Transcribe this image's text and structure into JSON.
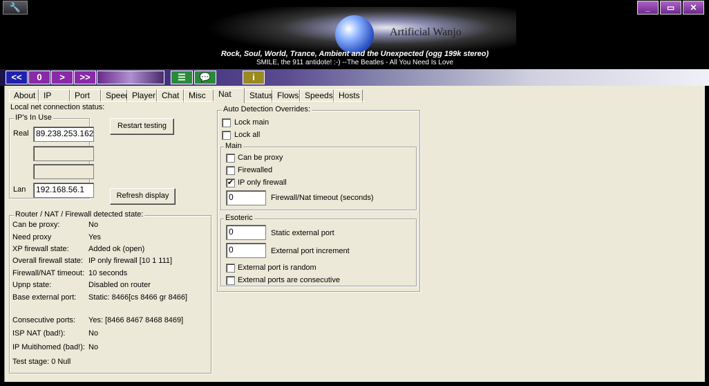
{
  "window": {
    "banner": {
      "title": "Artificial Wanjo",
      "song": "Rock, Soul, World, Trance, Ambient and the  Unexpected  (ogg 199k stereo)",
      "quote": "SMILE, the 911 antidote! :-) --The Beatles - All You Need Is Love"
    },
    "controls": {
      "minimize": "_",
      "restore": "▭",
      "close": "✕"
    }
  },
  "toolbar": {
    "prev": "<<",
    "zero": "0",
    "next": ">",
    "fastforward": ">>",
    "info": "i"
  },
  "tabs": [
    "About",
    "IP",
    "Port",
    "Speed",
    "Player",
    "Chat",
    "Misc",
    "Nat",
    "Status",
    "Flows",
    "Speeds",
    "Hosts"
  ],
  "active_tab": "Nat",
  "local": {
    "status_label": "Local net connection status:",
    "ips_group": "IP's In Use",
    "real_label": "Real",
    "real_value": "89.238.253.162",
    "lan_label": "Lan",
    "lan_value": "192.168.56.1",
    "restart_button": "Restart testing",
    "refresh_button": "Refresh display"
  },
  "router": {
    "group": "Router / NAT / Firewall detected state:",
    "rows": [
      {
        "label": "Can be proxy:",
        "value": "No"
      },
      {
        "label": "Need proxy",
        "value": "Yes"
      },
      {
        "label": "XP firewall state:",
        "value": "Added ok (open)"
      },
      {
        "label": "Overall firewall state:",
        "value": "IP only firewall [10 1 111]"
      },
      {
        "label": "Firewall/NAT timeout:",
        "value": "10 seconds"
      },
      {
        "label": "Upnp state:",
        "value": "Disabled on router"
      },
      {
        "label": "Base external port:",
        "value": "Static: 8466[cs 8466 gr 8466]"
      },
      {
        "label": "Consecutive ports:",
        "value": "Yes: [8466 8467 8468 8469]"
      },
      {
        "label": "ISP NAT (bad!):",
        "value": "No"
      },
      {
        "label": "IP Muitihomed (bad!):",
        "value": "No"
      }
    ],
    "test_stage": "Test stage:  0 Null"
  },
  "overrides": {
    "group": "Auto Detection Overrides:",
    "lock_main": {
      "label": "Lock main",
      "checked": false
    },
    "lock_all": {
      "label": "Lock all",
      "checked": false
    },
    "main_group": "Main",
    "can_be_proxy": {
      "label": "Can be proxy",
      "checked": false
    },
    "firewalled": {
      "label": "Firewalled",
      "checked": false
    },
    "ip_only_firewall": {
      "label": "IP only firewall",
      "checked": true
    },
    "timeout_value": "0",
    "timeout_label": "Firewall/Nat timeout (seconds)",
    "esoteric_group": "Esoteric",
    "static_port_value": "0",
    "static_port_label": "Static external port",
    "increment_value": "0",
    "increment_label": "External port increment",
    "random": {
      "label": "External port is random",
      "checked": false
    },
    "consecutive": {
      "label": "External ports are consecutive",
      "checked": false
    }
  },
  "colors": {
    "face": "#ece9d8",
    "title_bg": "#000000",
    "button_purple": "#8a2aa8",
    "button_blue": "#2020b0"
  }
}
